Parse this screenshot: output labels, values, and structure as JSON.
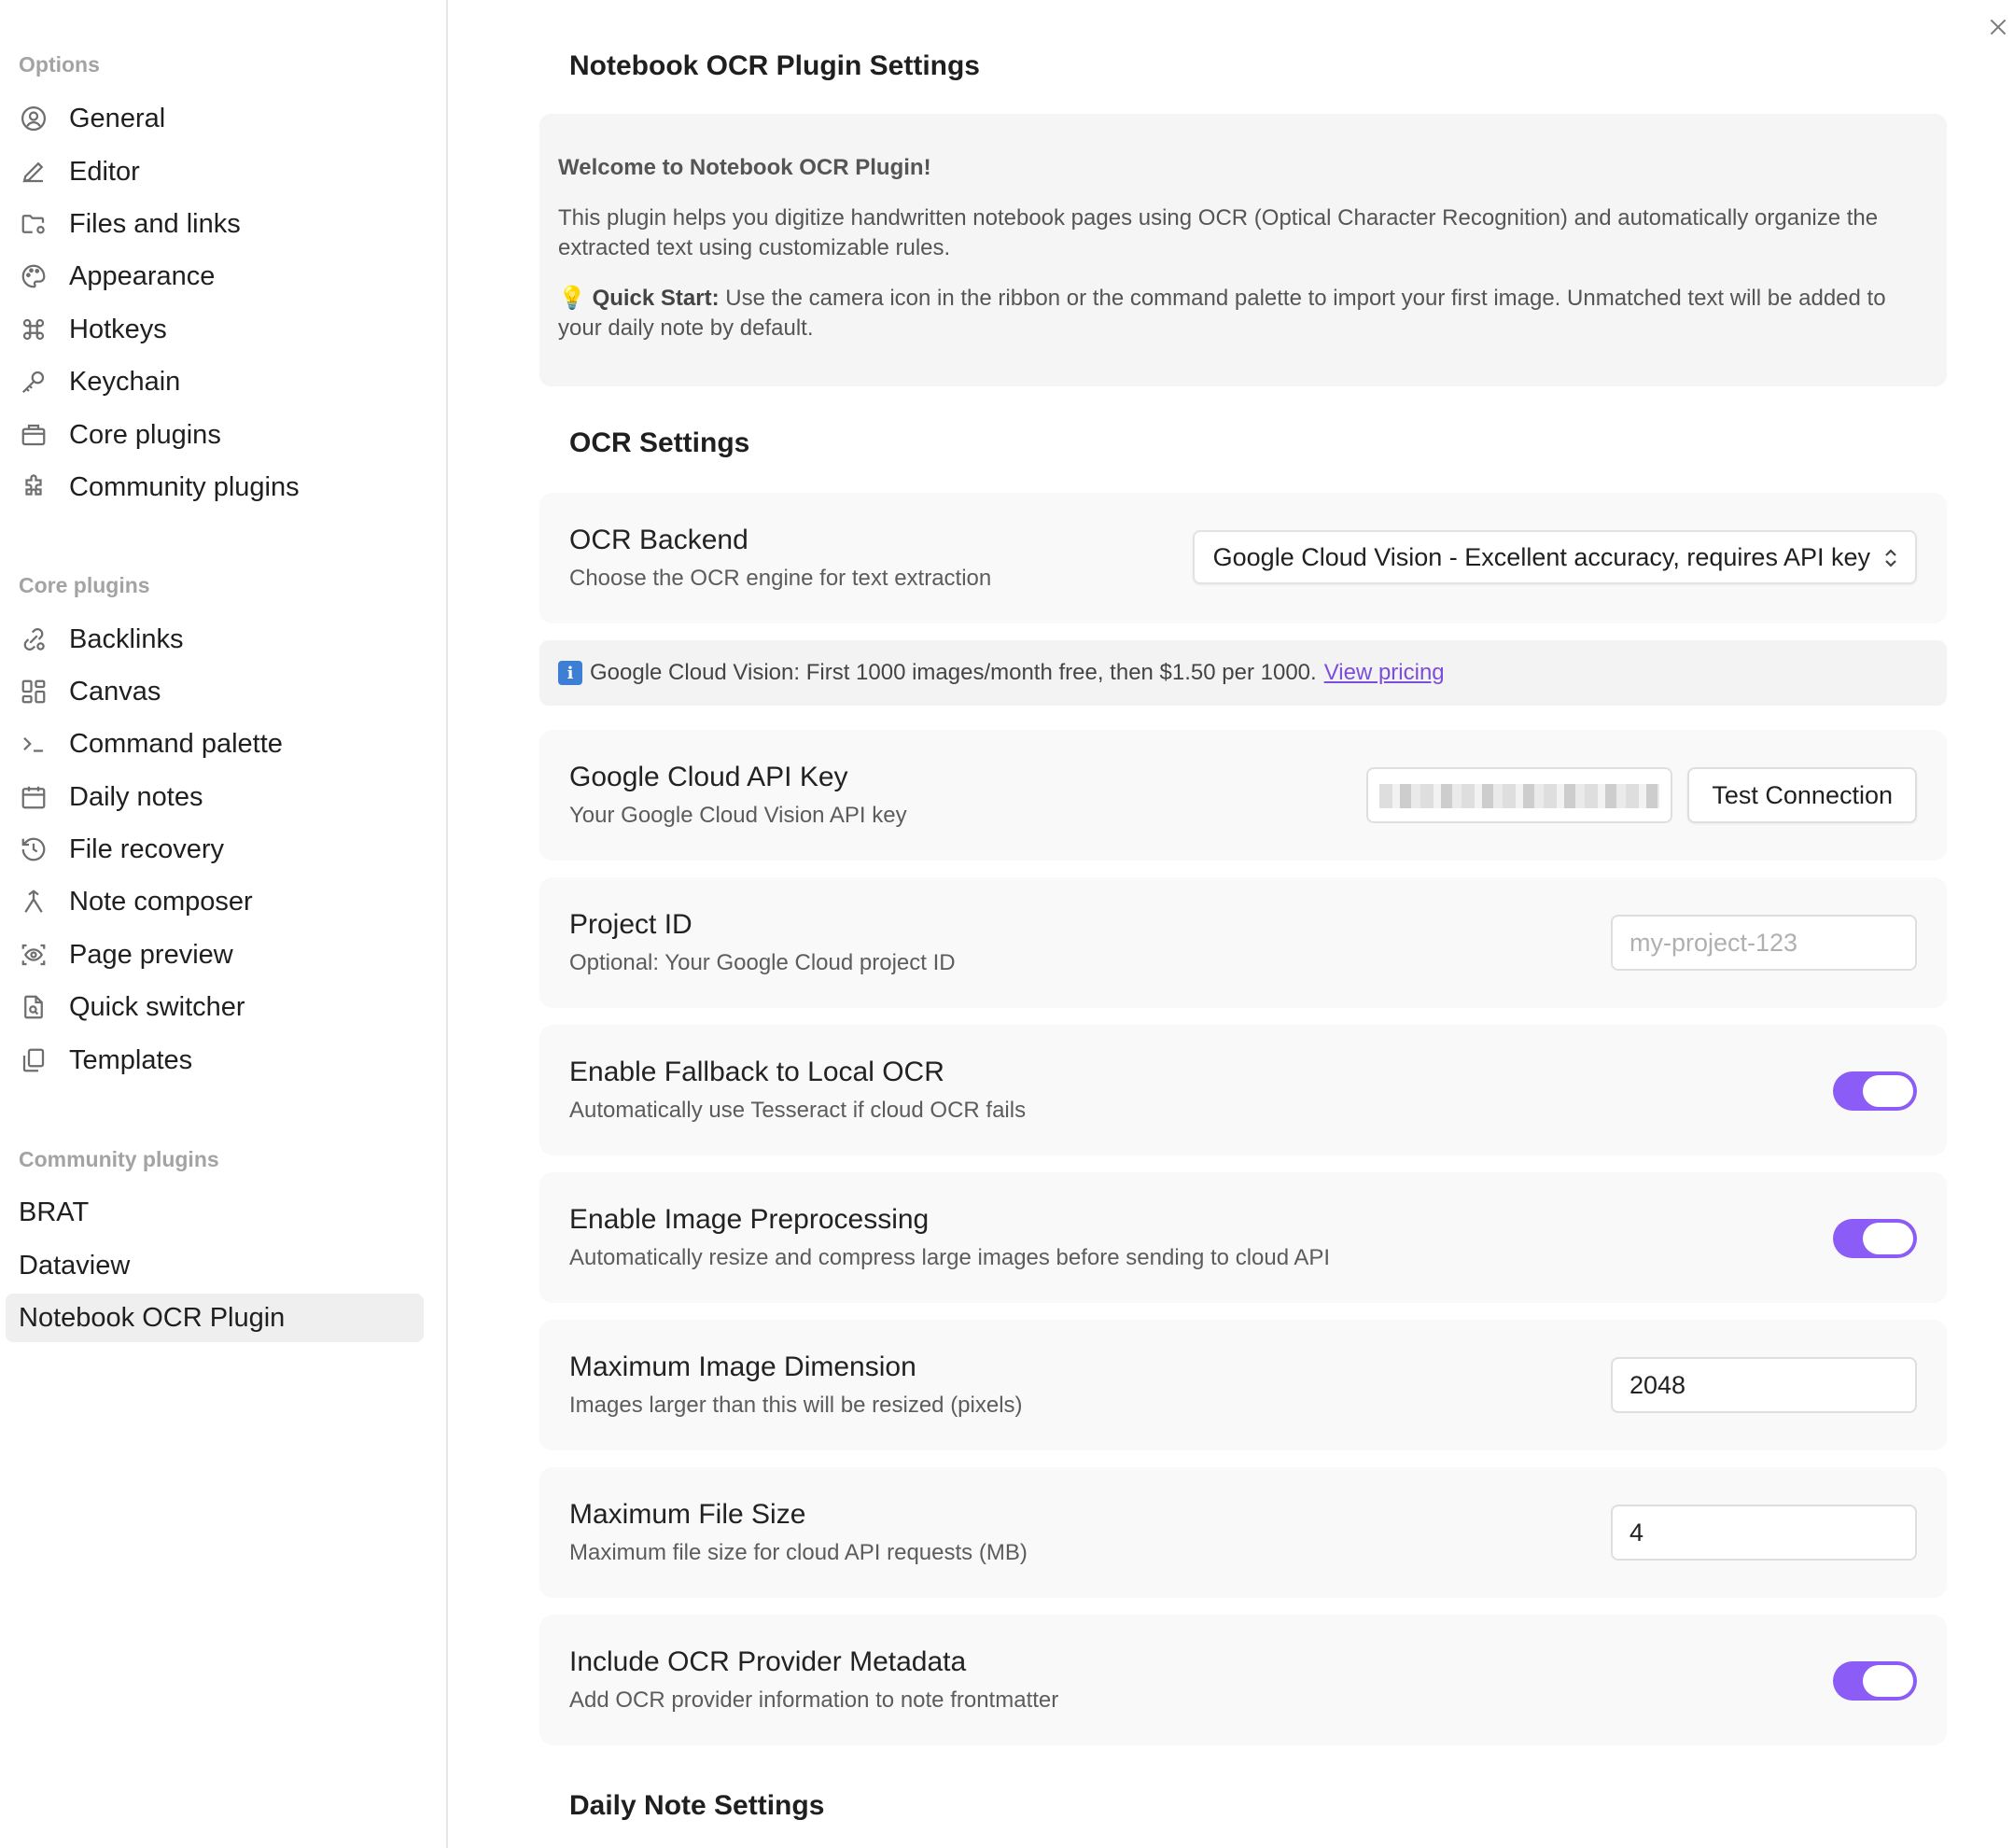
{
  "sidebar": {
    "options_heading": "Options",
    "options": [
      {
        "label": "General",
        "icon": "user-circle-icon"
      },
      {
        "label": "Editor",
        "icon": "pencil-icon"
      },
      {
        "label": "Files and links",
        "icon": "folder-cog-icon"
      },
      {
        "label": "Appearance",
        "icon": "palette-icon"
      },
      {
        "label": "Hotkeys",
        "icon": "command-icon"
      },
      {
        "label": "Keychain",
        "icon": "key-icon"
      },
      {
        "label": "Core plugins",
        "icon": "briefcase-icon"
      },
      {
        "label": "Community plugins",
        "icon": "puzzle-icon"
      }
    ],
    "core_heading": "Core plugins",
    "core": [
      {
        "label": "Backlinks",
        "icon": "link-search-icon"
      },
      {
        "label": "Canvas",
        "icon": "grid-icon"
      },
      {
        "label": "Command palette",
        "icon": "terminal-icon"
      },
      {
        "label": "Daily notes",
        "icon": "calendar-icon"
      },
      {
        "label": "File recovery",
        "icon": "history-icon"
      },
      {
        "label": "Note composer",
        "icon": "merge-icon"
      },
      {
        "label": "Page preview",
        "icon": "scan-eye-icon"
      },
      {
        "label": "Quick switcher",
        "icon": "file-search-icon"
      },
      {
        "label": "Templates",
        "icon": "copy-icon"
      }
    ],
    "community_heading": "Community plugins",
    "community": [
      {
        "label": "BRAT"
      },
      {
        "label": "Dataview"
      },
      {
        "label": "Notebook OCR Plugin",
        "active": true
      }
    ]
  },
  "main": {
    "title": "Notebook OCR Plugin Settings",
    "info": {
      "welcome": "Welcome to Notebook OCR Plugin!",
      "description": "This plugin helps you digitize handwritten notebook pages using OCR (Optical Character Recognition) and automatically organize the extracted text using customizable rules.",
      "quick_start_icon": "💡",
      "quick_start_label": "Quick Start:",
      "quick_start_text": " Use the camera icon in the ribbon or the command palette to import your first image. Unmatched text will be added to your daily note by default."
    },
    "ocr_heading": "OCR Settings",
    "backend": {
      "name": "OCR Backend",
      "desc": "Choose the OCR engine for text extraction",
      "selected": "Google Cloud Vision - Excellent accuracy, requires API key"
    },
    "notice": {
      "text": "Google Cloud Vision: First 1000 images/month free, then $1.50 per 1000.",
      "link": "View pricing"
    },
    "api_key": {
      "name": "Google Cloud API Key",
      "desc": "Your Google Cloud Vision API key",
      "button": "Test Connection"
    },
    "project": {
      "name": "Project ID",
      "desc": "Optional: Your Google Cloud project ID",
      "placeholder": "my-project-123"
    },
    "fallback": {
      "name": "Enable Fallback to Local OCR",
      "desc": "Automatically use Tesseract if cloud OCR fails",
      "enabled": true
    },
    "preprocess": {
      "name": "Enable Image Preprocessing",
      "desc": "Automatically resize and compress large images before sending to cloud API",
      "enabled": true
    },
    "max_dimension": {
      "name": "Maximum Image Dimension",
      "desc": "Images larger than this will be resized (pixels)",
      "value": "2048"
    },
    "max_file_size": {
      "name": "Maximum File Size",
      "desc": "Maximum file size for cloud API requests (MB)",
      "value": "4"
    },
    "metadata": {
      "name": "Include OCR Provider Metadata",
      "desc": "Add OCR provider information to note frontmatter",
      "enabled": true
    },
    "daily_heading": "Daily Note Settings"
  },
  "colors": {
    "accent": "#8b5cf6",
    "link": "#7c4ddb"
  }
}
